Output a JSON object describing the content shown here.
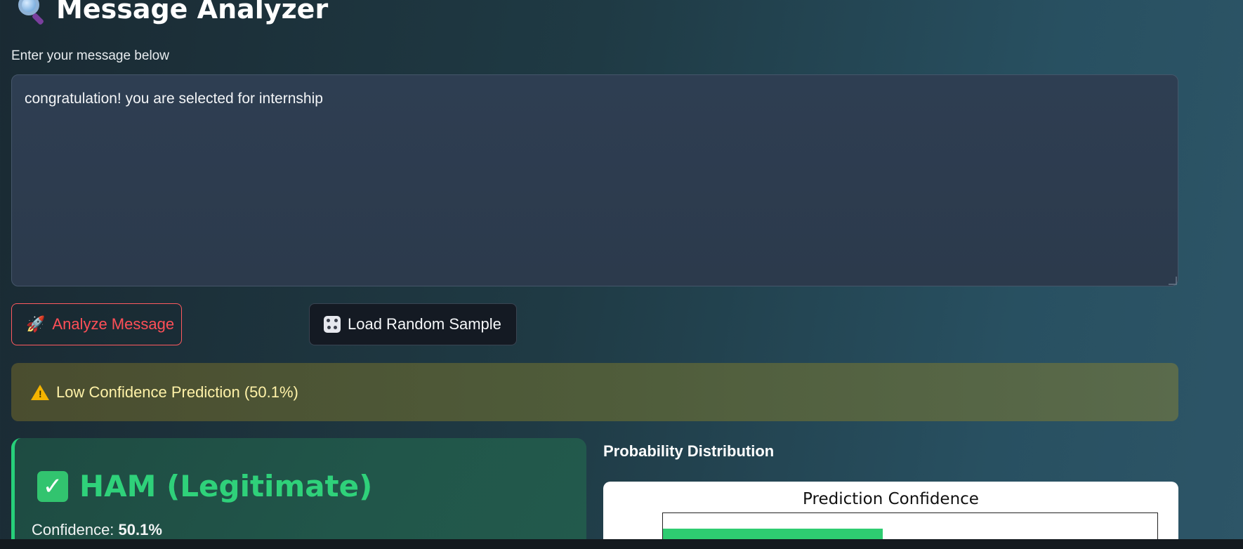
{
  "header": {
    "title": "Message Analyzer",
    "icon": "magnifying-glass-icon"
  },
  "input": {
    "label": "Enter your message below",
    "value": "congratulation! you are selected for internship"
  },
  "actions": {
    "analyze_label": "Analyze Message",
    "analyze_icon": "rocket-icon",
    "random_label": "Load Random Sample",
    "random_icon": "dice-icon"
  },
  "warning": {
    "icon": "warning-icon",
    "text": "Low Confidence Prediction (50.1%)"
  },
  "result": {
    "icon": "check-icon",
    "label": "HAM (Legitimate)",
    "confidence_label": "Confidence:",
    "confidence_value": "50.1%",
    "color": "#2fd17a"
  },
  "distribution": {
    "heading": "Probability Distribution"
  },
  "chart_data": {
    "type": "bar",
    "title": "Prediction Confidence",
    "series": [
      {
        "value": 50.1,
        "color": "#2ecc71"
      }
    ],
    "xlim": [
      0,
      100
    ]
  }
}
